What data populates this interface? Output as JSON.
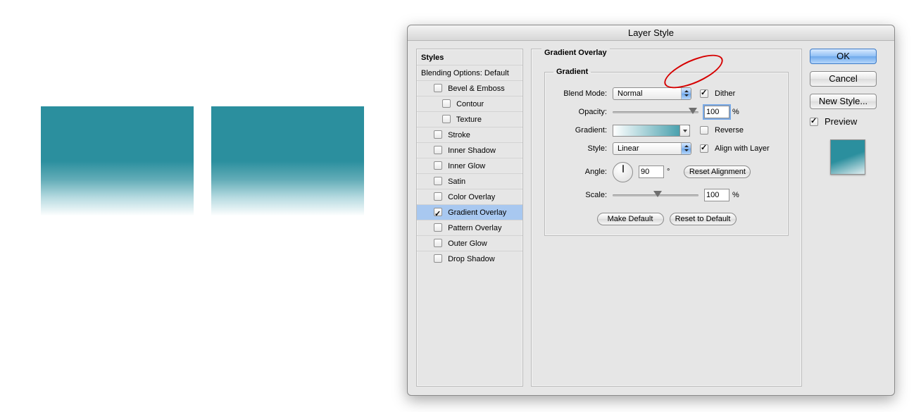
{
  "window_title": "Layer Style",
  "styles": {
    "header": "Styles",
    "subheader": "Blending Options: Default",
    "items": [
      {
        "label": "Bevel & Emboss",
        "on": false,
        "indent": 1
      },
      {
        "label": "Contour",
        "on": false,
        "indent": 2
      },
      {
        "label": "Texture",
        "on": false,
        "indent": 2
      },
      {
        "label": "Stroke",
        "on": false,
        "indent": 1
      },
      {
        "label": "Inner Shadow",
        "on": false,
        "indent": 1
      },
      {
        "label": "Inner Glow",
        "on": false,
        "indent": 1
      },
      {
        "label": "Satin",
        "on": false,
        "indent": 1
      },
      {
        "label": "Color Overlay",
        "on": false,
        "indent": 1
      },
      {
        "label": "Gradient Overlay",
        "on": true,
        "indent": 1,
        "selected": true
      },
      {
        "label": "Pattern Overlay",
        "on": false,
        "indent": 1
      },
      {
        "label": "Outer Glow",
        "on": false,
        "indent": 1
      },
      {
        "label": "Drop Shadow",
        "on": false,
        "indent": 1
      }
    ]
  },
  "overlay": {
    "group_title": "Gradient Overlay",
    "fieldset_title": "Gradient",
    "blend_mode_label": "Blend Mode:",
    "blend_mode_value": "Normal",
    "dither_label": "Dither",
    "dither_on": true,
    "opacity_label": "Opacity:",
    "opacity_value": "100",
    "opacity_unit": "%",
    "gradient_label": "Gradient:",
    "reverse_label": "Reverse",
    "reverse_on": false,
    "style_label": "Style:",
    "style_value": "Linear",
    "align_label": "Align with Layer",
    "align_on": true,
    "angle_label": "Angle:",
    "angle_value": "90",
    "angle_unit": "°",
    "reset_align_label": "Reset Alignment",
    "scale_label": "Scale:",
    "scale_value": "100",
    "scale_unit": "%",
    "make_default_label": "Make Default",
    "reset_default_label": "Reset to Default"
  },
  "actions": {
    "ok": "OK",
    "cancel": "Cancel",
    "new_style": "New Style...",
    "preview_label": "Preview",
    "preview_on": true
  },
  "colors": {
    "teal_dark": "#2b8f9e",
    "teal_light": "#b7dbe1"
  }
}
